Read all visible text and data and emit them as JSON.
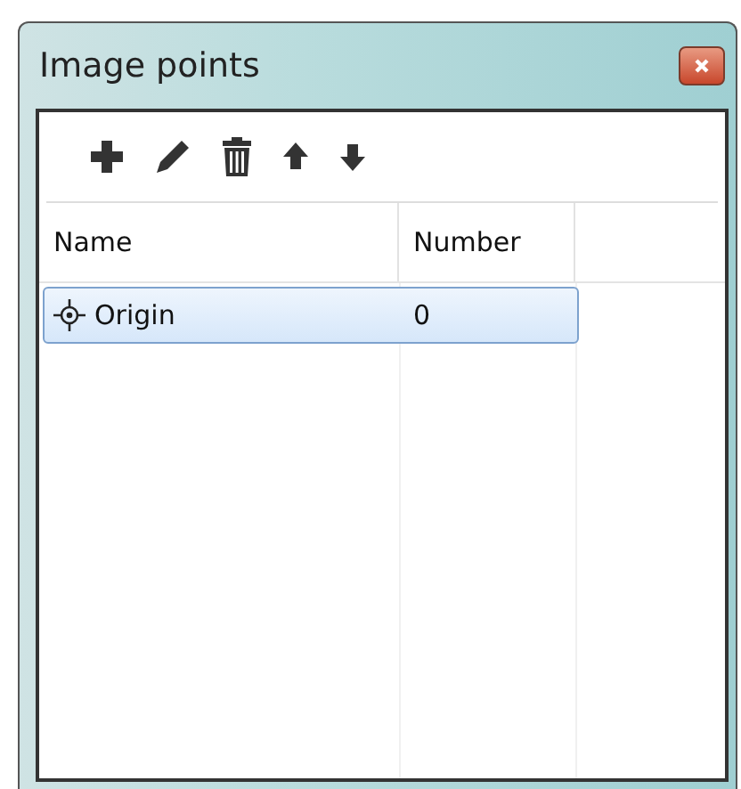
{
  "window": {
    "title": "Image points"
  },
  "table": {
    "columns": [
      "Name",
      "Number"
    ],
    "rows": [
      {
        "name": "Origin",
        "number": "0",
        "selected": true
      }
    ]
  }
}
